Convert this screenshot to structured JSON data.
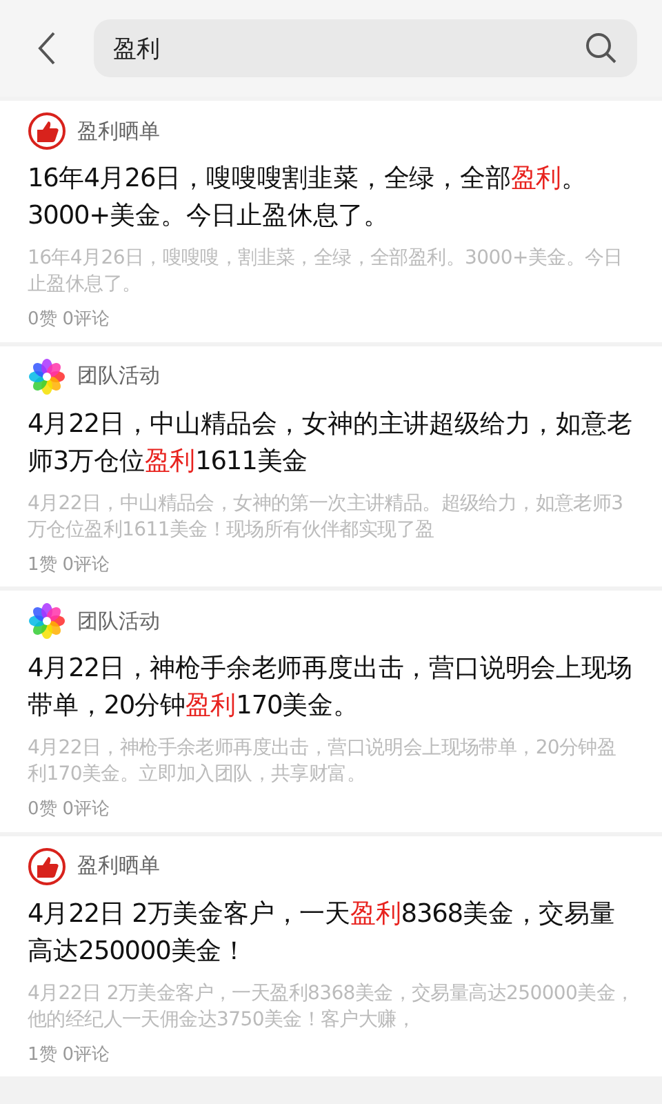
{
  "search": {
    "value": "盈利"
  },
  "posts": [
    {
      "category": "盈利晒单",
      "kind": "thumb",
      "title": [
        {
          "text": "16年4月26日，嗖嗖嗖割韭菜，全绿，全部",
          "highlight": false
        },
        {
          "text": "盈利",
          "highlight": true
        },
        {
          "text": "。3000+美金。今日止盈休息了。",
          "highlight": false
        }
      ],
      "summary": "16年4月26日，嗖嗖嗖，割韭菜，全绿，全部盈利。3000+美金。今日止盈休息了。",
      "likes": "0赞",
      "comments": "0评论"
    },
    {
      "category": "团队活动",
      "kind": "flower",
      "title": [
        {
          "text": "4月22日，中山精品会，女神的主讲超级给力，如意老师3万仓位",
          "highlight": false
        },
        {
          "text": "盈利",
          "highlight": true
        },
        {
          "text": "1611美金",
          "highlight": false
        }
      ],
      "summary": "4月22日，中山精品会，女神的第一次主讲精品。超级给力，如意老师3万仓位盈利1611美金！现场所有伙伴都实现了盈",
      "likes": "1赞",
      "comments": "0评论"
    },
    {
      "category": "团队活动",
      "kind": "flower",
      "title": [
        {
          "text": "4月22日，神枪手余老师再度出击，营口说明会上现场带单，20分钟",
          "highlight": false
        },
        {
          "text": "盈利",
          "highlight": true
        },
        {
          "text": "170美金。",
          "highlight": false
        }
      ],
      "summary": "4月22日，神枪手余老师再度出击，营口说明会上现场带单，20分钟盈利170美金。立即加入团队，共享财富。",
      "likes": "0赞",
      "comments": "0评论"
    },
    {
      "category": "盈利晒单",
      "kind": "thumb",
      "title": [
        {
          "text": "4月22日 2万美金客户，一天",
          "highlight": false
        },
        {
          "text": "盈利",
          "highlight": true
        },
        {
          "text": "8368美金，交易量高达250000美金！",
          "highlight": false
        }
      ],
      "summary": "4月22日 2万美金客户，一天盈利8368美金，交易量高达250000美金，他的经纪人一天佣金达3750美金！客户大赚，",
      "likes": "1赞",
      "comments": "0评论"
    }
  ]
}
